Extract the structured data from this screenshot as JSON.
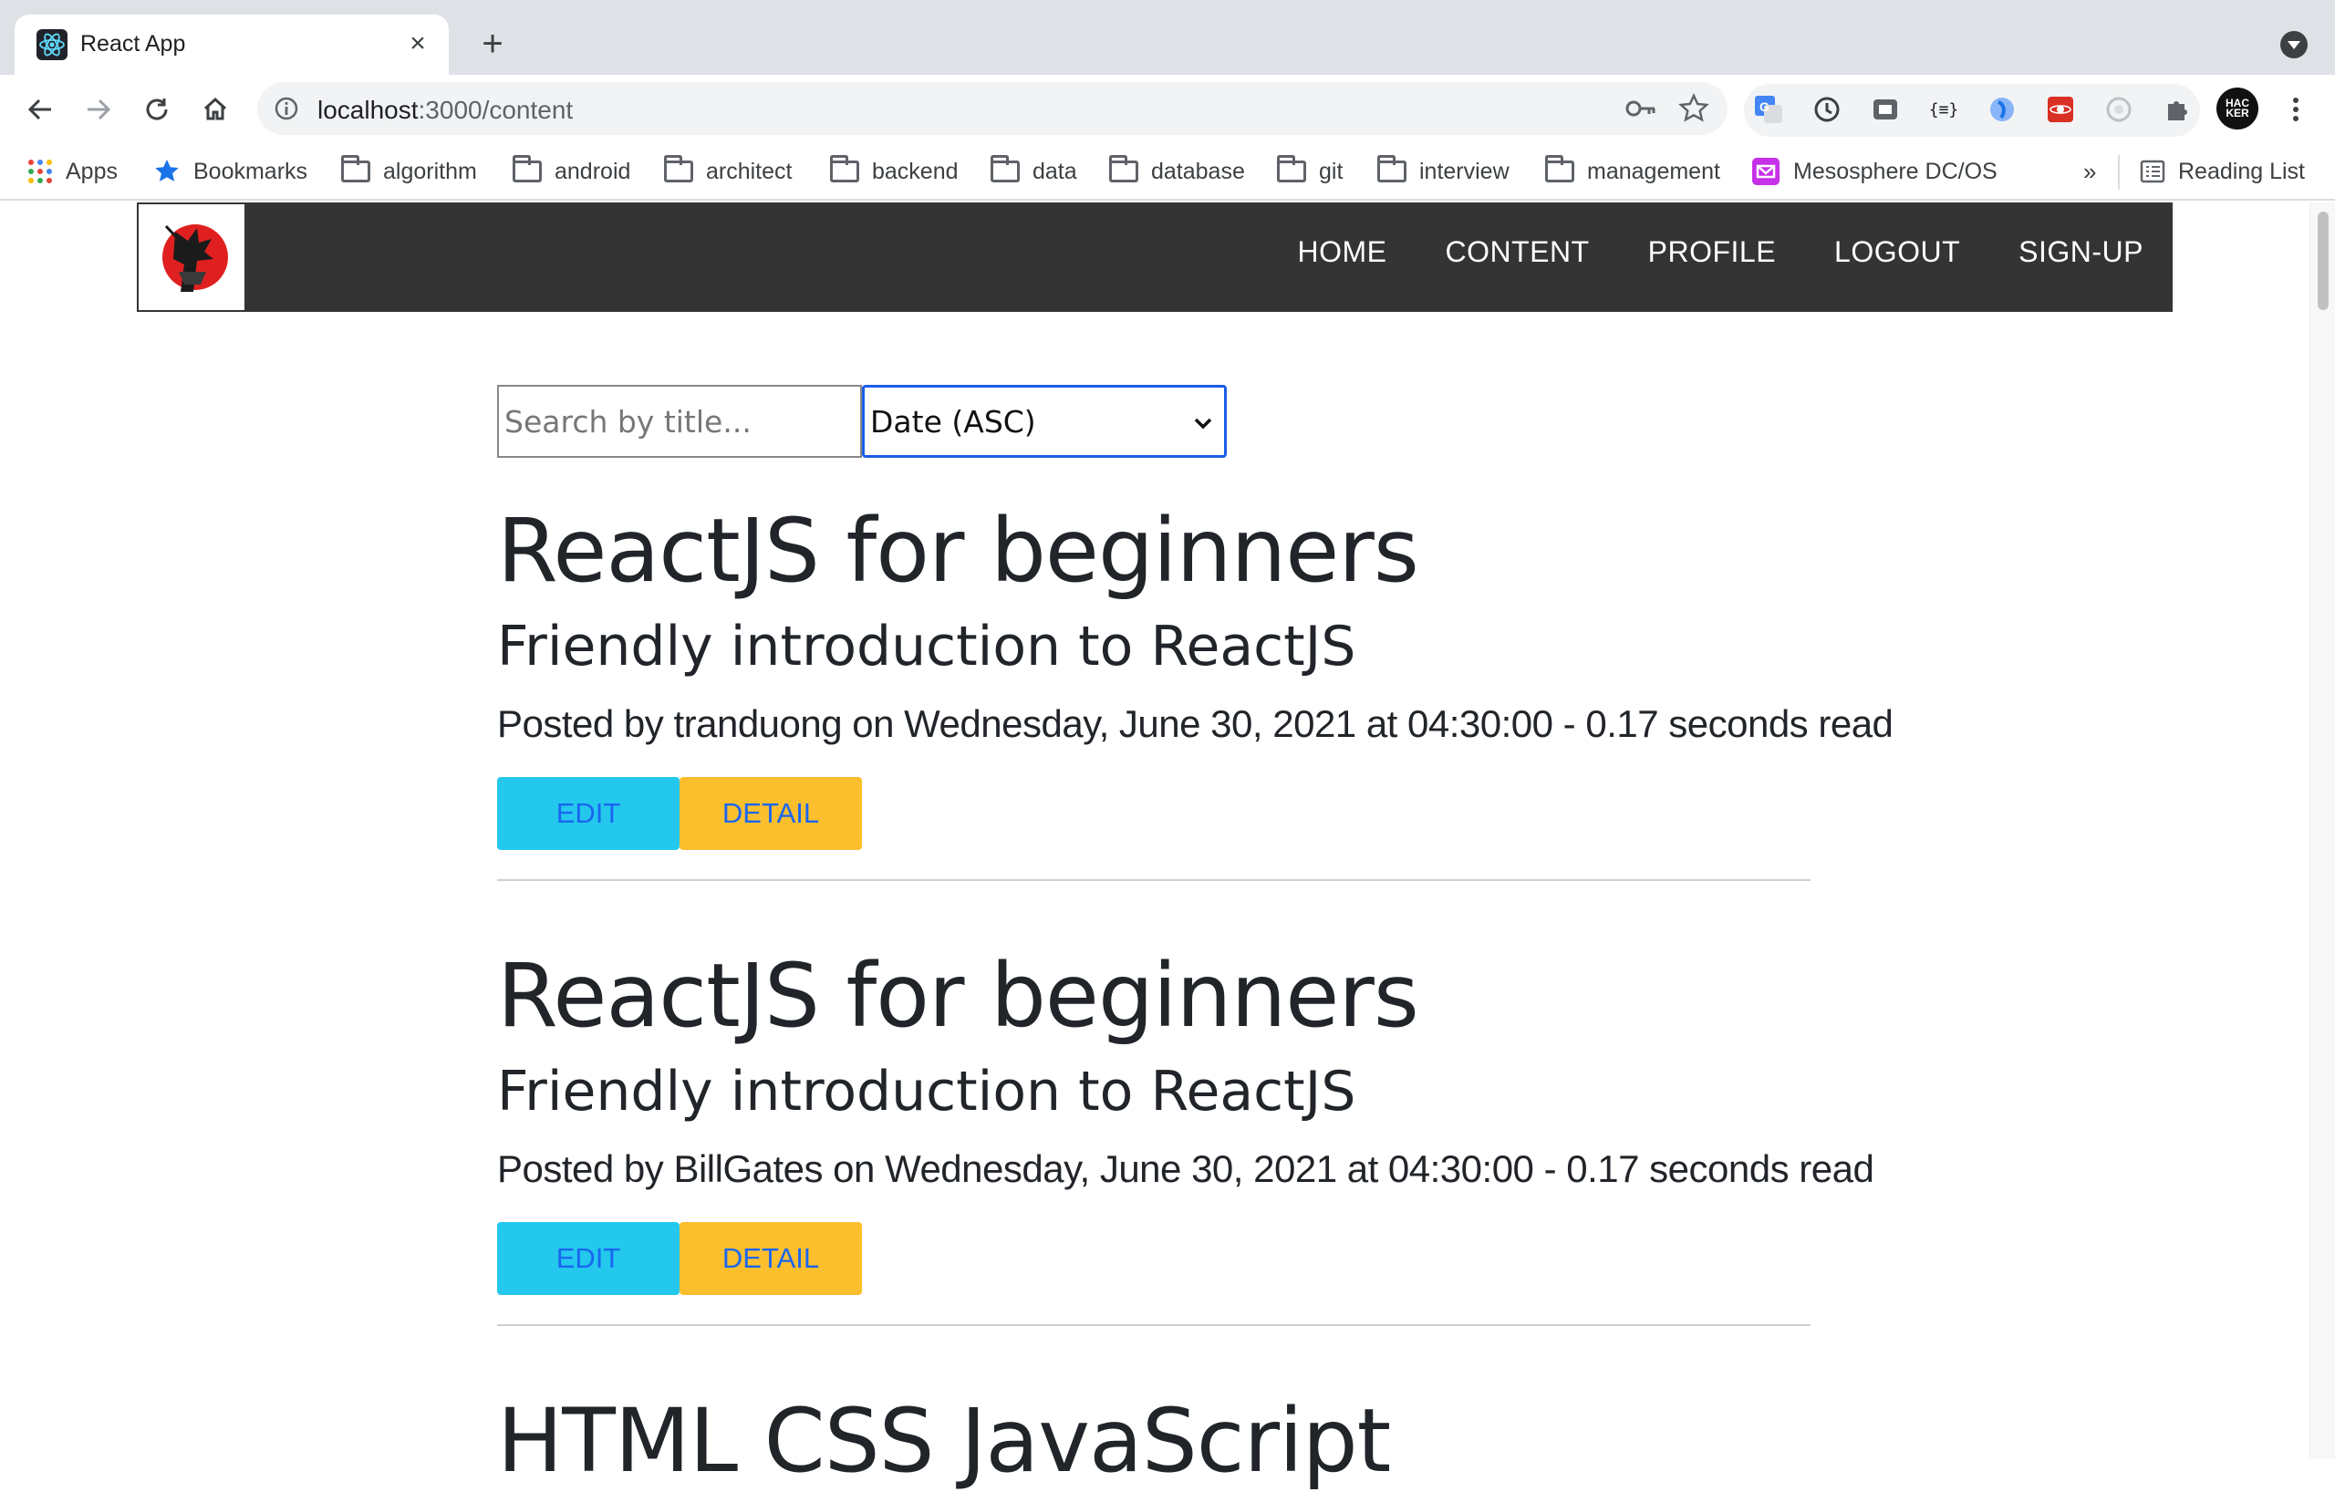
{
  "browser": {
    "tab_title": "React App",
    "url_host": "localhost",
    "url_path": ":3000/content",
    "bookmarks": [
      {
        "label": "Apps",
        "icon": "apps-grid-icon"
      },
      {
        "label": "Bookmarks",
        "icon": "star-icon"
      },
      {
        "label": "algorithm",
        "icon": "folder-icon"
      },
      {
        "label": "android",
        "icon": "folder-icon"
      },
      {
        "label": "architect",
        "icon": "folder-icon"
      },
      {
        "label": "backend",
        "icon": "folder-icon"
      },
      {
        "label": "data",
        "icon": "folder-icon"
      },
      {
        "label": "database",
        "icon": "folder-icon"
      },
      {
        "label": "git",
        "icon": "folder-icon"
      },
      {
        "label": "interview",
        "icon": "folder-icon"
      },
      {
        "label": "management",
        "icon": "folder-icon"
      },
      {
        "label": "Mesosphere DC/OS",
        "icon": "mesosphere-icon"
      }
    ],
    "overflow_label": "»",
    "reading_list": "Reading List",
    "profile_label": "HACKER"
  },
  "nav": {
    "links": [
      "HOME",
      "CONTENT",
      "PROFILE",
      "LOGOUT",
      "SIGN-UP"
    ]
  },
  "controls": {
    "search_placeholder": "Search by title...",
    "sort_selected": "Date (ASC)"
  },
  "posts": [
    {
      "title": "ReactJS for beginners",
      "subtitle": "Friendly introduction to ReactJS",
      "meta": "Posted by tranduong on Wednesday, June 30, 2021 at 04:30:00 - 0.17 seconds read",
      "edit_label": "EDIT",
      "detail_label": "DETAIL"
    },
    {
      "title": "ReactJS for beginners",
      "subtitle": "Friendly introduction to ReactJS",
      "meta": "Posted by BillGates on Wednesday, June 30, 2021 at 04:30:00 - 0.17 seconds read",
      "edit_label": "EDIT",
      "detail_label": "DETAIL"
    },
    {
      "title": "HTML CSS JavaScript"
    }
  ],
  "colors": {
    "navbar": "#343434",
    "edit_button": "#23c8ec",
    "detail_button": "#fbbf2e",
    "button_text": "#1a66f0",
    "select_focus": "#1a5ee8"
  }
}
